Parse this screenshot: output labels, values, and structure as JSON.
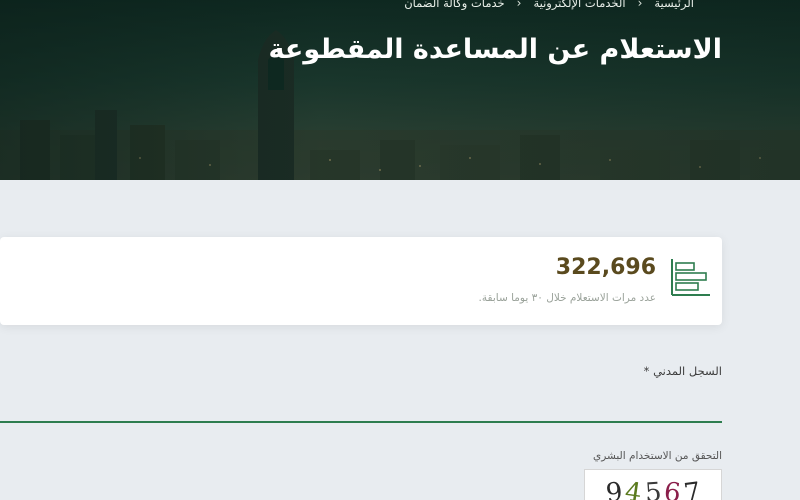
{
  "breadcrumb": {
    "items": [
      "الرئيسية",
      "الخدمات الإلكترونية",
      "خدمات وكالة الضمان"
    ],
    "separator": "‹"
  },
  "page_title": "الاستعلام عن المساعدة المقطوعة",
  "stats": {
    "value": "322,696",
    "label": "عدد مرات الاستعلام خلال ٣٠ يوما سابقة.",
    "icon": "horizontal-bar-chart-icon"
  },
  "form": {
    "civil_registry_label": "السجل المدني *",
    "civil_registry_value": "",
    "captcha_label": "التحقق من الاستخدام البشري",
    "captcha_digits": [
      "9",
      "4",
      "5",
      "6",
      "7"
    ]
  },
  "colors": {
    "accent_green": "#2e7d4f",
    "stat_value": "#5a4a1e",
    "page_bg": "#e8ecf0"
  }
}
